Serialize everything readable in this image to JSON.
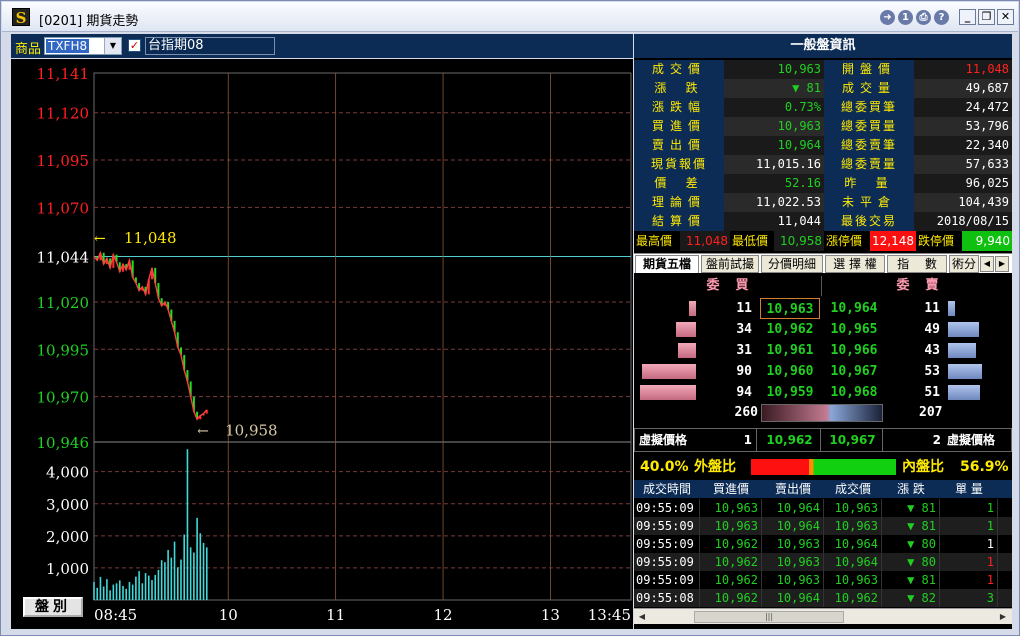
{
  "window": {
    "app_icon": "S",
    "title": "[0201] 期貨走勢",
    "buttons": [
      "back-icon",
      "info-icon",
      "print-icon",
      "help-icon",
      "minimize-icon",
      "maximize-icon",
      "close-icon"
    ]
  },
  "product_bar": {
    "label": "商品",
    "code": "TXFH8",
    "name": "台指期08"
  },
  "chart_data": {
    "type": "line",
    "time_labels": [
      "08:45",
      "10",
      "11",
      "12",
      "13",
      "13:45"
    ],
    "price_ticks": [
      "11,141",
      "11,120",
      "11,095",
      "11,070",
      "11,044",
      "11,020",
      "10,995",
      "10,970",
      "10,946"
    ],
    "price_tick_colors": [
      "red",
      "red",
      "red",
      "red",
      "white",
      "green",
      "green",
      "green",
      "green"
    ],
    "ylim": [
      10946,
      11141
    ],
    "reference_price": 11044,
    "high_label": "11,048",
    "low_label": "10,958",
    "high_value": 11048,
    "low_value": 10958,
    "volume_ticks": [
      "4,000",
      "3,000",
      "2,000",
      "1,000"
    ],
    "volume_ylim": [
      0,
      4800
    ],
    "minutes": [
      0,
      2,
      4,
      6,
      8,
      10,
      12,
      14,
      16,
      18,
      20,
      22,
      24,
      26,
      28,
      30,
      32,
      34,
      36,
      38,
      40,
      42,
      44,
      46,
      48,
      50,
      52,
      54,
      56,
      58,
      60,
      62,
      64,
      66,
      68,
      70
    ],
    "prices": [
      11044,
      11042,
      11046,
      11040,
      11043,
      11038,
      11045,
      11041,
      11036,
      11040,
      11037,
      11042,
      11033,
      11030,
      11026,
      11028,
      11024,
      11032,
      11038,
      11030,
      11022,
      11018,
      11020,
      11016,
      11010,
      11004,
      10996,
      10992,
      10984,
      10978,
      10970,
      10962,
      10958,
      10960,
      10961,
      10963
    ],
    "volumes": [
      560,
      380,
      720,
      420,
      650,
      300,
      480,
      520,
      610,
      440,
      350,
      560,
      480,
      730,
      900,
      520,
      840,
      760,
      620,
      780,
      940,
      1240,
      1180,
      1560,
      1320,
      1820,
      1020,
      1260,
      2040,
      4700,
      1640,
      1480,
      2560,
      2080,
      1780,
      1640
    ]
  },
  "market_button": "盤別",
  "quote": {
    "header": "一般盤資訊",
    "rows": [
      {
        "l1": "成交價",
        "v1": "10,963",
        "c1": "green",
        "l2": "開盤價",
        "v2": "11,048",
        "c2": "red"
      },
      {
        "l1": "漲 跌",
        "v1": "▼ 81",
        "c1": "green",
        "l2": "成交量",
        "v2": "49,687",
        "c2": "white"
      },
      {
        "l1": "漲跌幅",
        "v1": "0.73%",
        "c1": "green",
        "l2": "總委買筆",
        "v2": "24,472",
        "c2": "white"
      },
      {
        "l1": "買進價",
        "v1": "10,963",
        "c1": "green",
        "l2": "總委買量",
        "v2": "53,796",
        "c2": "white"
      },
      {
        "l1": "賣出價",
        "v1": "10,964",
        "c1": "green",
        "l2": "總委賣筆",
        "v2": "22,340",
        "c2": "white"
      },
      {
        "l1": "現貨報價",
        "v1": "11,015.16",
        "c1": "white",
        "l2": "總委賣量",
        "v2": "57,633",
        "c2": "white"
      },
      {
        "l1": "價 差",
        "v1": "52.16",
        "c1": "green",
        "l2": "昨 量",
        "v2": "96,025",
        "c2": "white"
      },
      {
        "l1": "理論價",
        "v1": "11,022.53",
        "c1": "white",
        "l2": "未平倉",
        "v2": "104,439",
        "c2": "white"
      },
      {
        "l1": "結算價",
        "v1": "11,044",
        "c1": "white",
        "l2": "最後交易",
        "v2": "2018/08/15",
        "c2": "white"
      }
    ]
  },
  "limits": {
    "high_label": "最高價",
    "high": "11,048",
    "low_label": "最低價",
    "low": "10,958",
    "up_label": "漲停價",
    "up": "12,148",
    "down_label": "跌停價",
    "down": "9,940"
  },
  "tabs": [
    "期貨五檔",
    "盤前試撮",
    "分價明細",
    "選 擇 權",
    "指　 數",
    "術分"
  ],
  "orderbook": {
    "bid_label": "委買",
    "ask_label": "委賣",
    "rows": [
      {
        "bq": "11",
        "bp": "10,963",
        "ap": "10,964",
        "aq": "11",
        "bf": 0.12,
        "af": 0.12
      },
      {
        "bq": "34",
        "bp": "10,962",
        "ap": "10,965",
        "aq": "49",
        "bf": 0.36,
        "af": 0.52
      },
      {
        "bq": "31",
        "bp": "10,961",
        "ap": "10,966",
        "aq": "43",
        "bf": 0.33,
        "af": 0.46
      },
      {
        "bq": "90",
        "bp": "10,960",
        "ap": "10,967",
        "aq": "53",
        "bf": 0.96,
        "af": 0.56
      },
      {
        "bq": "94",
        "bp": "10,959",
        "ap": "10,968",
        "aq": "51",
        "bf": 1.0,
        "af": 0.54
      }
    ],
    "bid_total": "260",
    "ask_total": "207",
    "bid_share": 0.557
  },
  "virtual": {
    "label_left": "虛擬價格",
    "qty_left": "1",
    "price_bid": "10,962",
    "price_ask": "10,967",
    "qty_right": "2",
    "label_right": "虛擬價格"
  },
  "ratio": {
    "out_pct": "40.0%",
    "out_label": "外盤比",
    "in_label": "內盤比",
    "in_pct": "56.9%",
    "out_share": 0.4,
    "in_share": 0.569
  },
  "ticks": {
    "headers": [
      "成交時間",
      "買進價",
      "賣出價",
      "成交價",
      "漲 跌",
      "單 量"
    ],
    "rows": [
      {
        "t": "09:55:09",
        "b": "10,963",
        "a": "10,964",
        "p": "10,963",
        "d": "▼ 81",
        "q": "1",
        "qc": "green"
      },
      {
        "t": "09:55:09",
        "b": "10,963",
        "a": "10,964",
        "p": "10,963",
        "d": "▼ 81",
        "q": "1",
        "qc": "green"
      },
      {
        "t": "09:55:09",
        "b": "10,962",
        "a": "10,963",
        "p": "10,964",
        "d": "▼ 80",
        "q": "1",
        "qc": "white"
      },
      {
        "t": "09:55:09",
        "b": "10,962",
        "a": "10,963",
        "p": "10,964",
        "d": "▼ 80",
        "q": "1",
        "qc": "red"
      },
      {
        "t": "09:55:09",
        "b": "10,962",
        "a": "10,963",
        "p": "10,963",
        "d": "▼ 81",
        "q": "1",
        "qc": "red"
      },
      {
        "t": "09:55:08",
        "b": "10,962",
        "a": "10,964",
        "p": "10,962",
        "d": "▼ 82",
        "q": "3",
        "qc": "green"
      }
    ]
  },
  "colors": {
    "up": "#ff2020",
    "down": "#20d020",
    "neutral": "#ffffff",
    "label": "#ffea00",
    "navy": "#0c2c56",
    "ref_line": "#4fd0d0",
    "volume": "#40d8d8"
  }
}
